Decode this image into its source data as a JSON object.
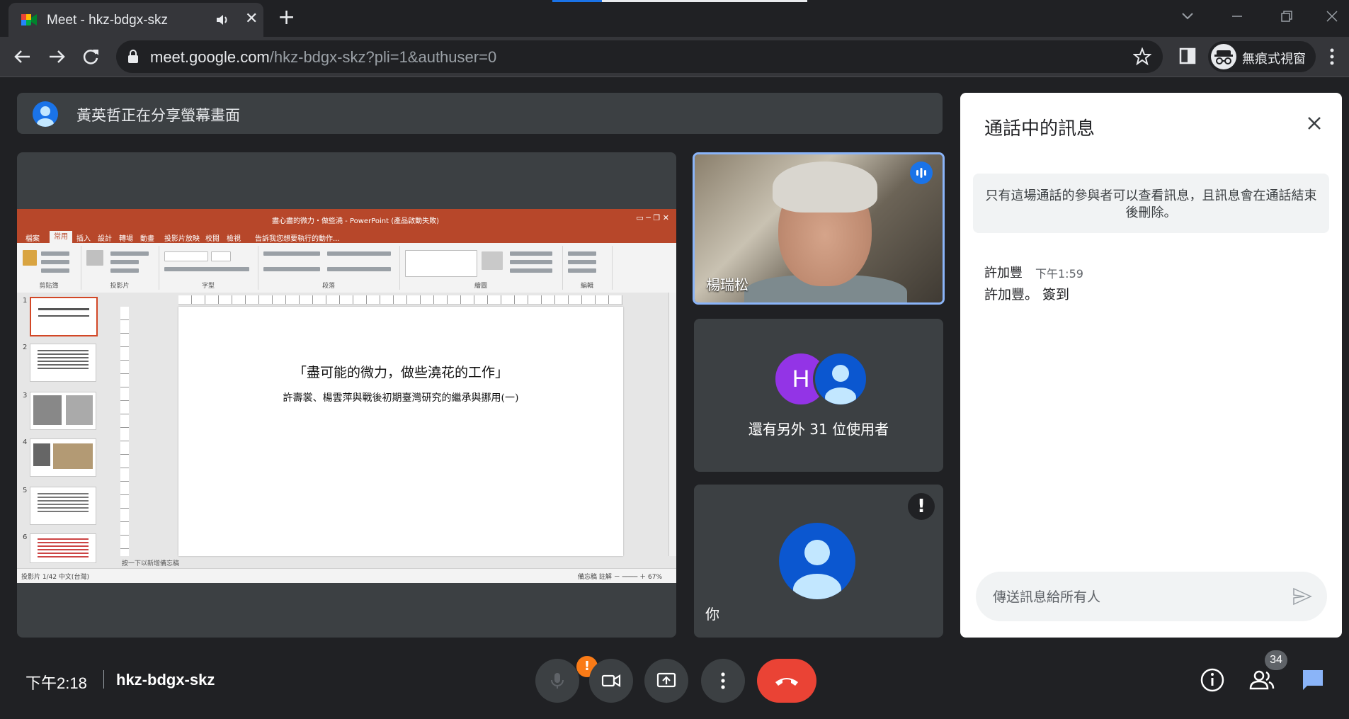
{
  "browser": {
    "tab_title": "Meet - hkz-bdgx-skz",
    "url_host": "meet.google.com",
    "url_path": "/hkz-bdgx-skz?pli=1&authuser=0",
    "incognito_label": "無痕式視窗"
  },
  "meet": {
    "presenting_banner": "黃英哲正在分享螢幕畫面",
    "speaker_name": "楊瑞松",
    "others_label": "還有另外 31 位使用者",
    "others_initial": "H",
    "you_label": "你",
    "alert_mark": "!",
    "time": "下午2:18",
    "meeting_code": "hkz-bdgx-skz",
    "participant_count": "34",
    "mic_alert": "!"
  },
  "presentation": {
    "window_title": "盡心盡的微力・做些澆 - PowerPoint (產品啟動失敗)",
    "tabs": [
      "檔案",
      "常用",
      "插入",
      "設計",
      "轉場",
      "動畫",
      "投影片放映",
      "校閱",
      "檢視"
    ],
    "tell_me": "告訴我您想要執行的動作...",
    "ribbon_groups": [
      "剪貼簿",
      "投影片",
      "字型",
      "段落",
      "繪圖",
      "編輯"
    ],
    "slide_title": "「盡可能的微力，做些澆花的工作」",
    "slide_subtitle": "許壽裳、楊雲萍與戰後初期臺灣研究的繼承與挪用(一)",
    "thumb_numbers": [
      "1",
      "2",
      "3",
      "4",
      "5",
      "6"
    ],
    "notes_placeholder": "按一下以新增備忘稿",
    "status_left": "投影片 1/42    中文(台灣)",
    "status_right": "備忘稿   註解        －  ────  ＋  67%"
  },
  "chat": {
    "title": "通話中的訊息",
    "notice": "只有這場通話的參與者可以查看訊息，且訊息會在通話結束後刪除。",
    "messages": [
      {
        "author": "許加豐",
        "time": "下午1:59",
        "text": "許加豐。 簽到"
      }
    ],
    "input_placeholder": "傳送訊息給所有人"
  },
  "colors": {
    "meet_bg": "#202124",
    "tile_bg": "#3c4043",
    "accent_blue": "#8ab4f8",
    "hangup_red": "#ea4335",
    "ppt_orange": "#b7472a",
    "alert_orange": "#fa7b17"
  }
}
